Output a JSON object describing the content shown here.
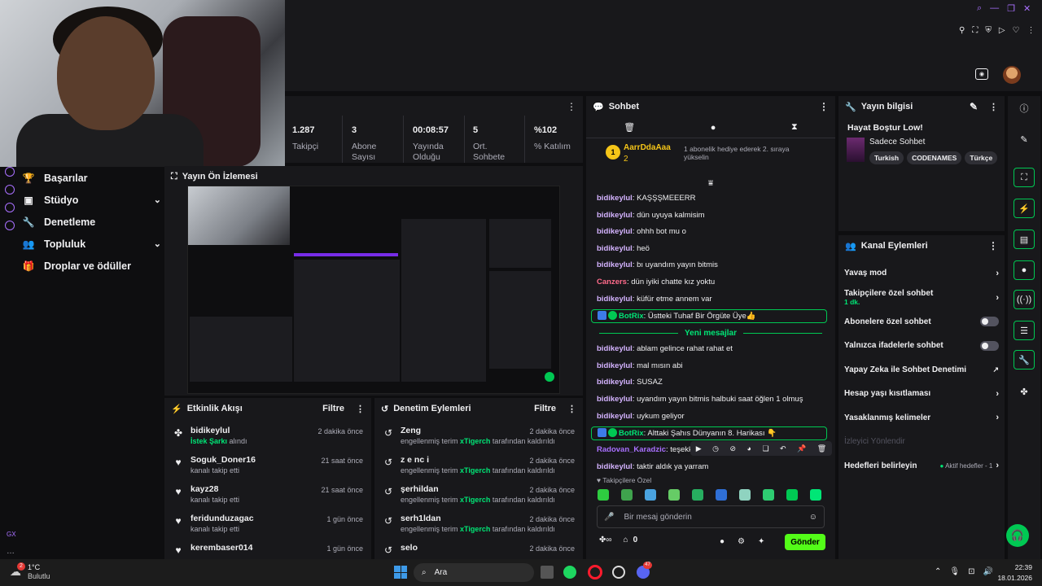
{
  "top": {
    "avatar_alt": "profile"
  },
  "nav": {
    "items": [
      {
        "label": "Başarılar",
        "icon": "trophy-icon",
        "expand": false
      },
      {
        "label": "Stüdyo",
        "icon": "video-icon",
        "expand": true
      },
      {
        "label": "Denetleme",
        "icon": "wrench-icon",
        "expand": false
      },
      {
        "label": "Topluluk",
        "icon": "people-icon",
        "expand": true
      },
      {
        "label": "Droplar ve ödüller",
        "icon": "gift-icon",
        "expand": false
      }
    ],
    "footer_label": "GX"
  },
  "stats": [
    {
      "value": "1.287",
      "label": "Takipçi"
    },
    {
      "value": "3",
      "label": "Abone Sayısı"
    },
    {
      "value": "00:08:57",
      "label": "Yayında Olduğu"
    },
    {
      "value": "5",
      "label": "Ort. Sohbete"
    },
    {
      "value": "%102",
      "label": "% Katılım"
    }
  ],
  "preview": {
    "title": "Yayın Ön İzlemesi"
  },
  "feed": {
    "title": "Etkinlik Akışı",
    "filter": "Filtre",
    "items": [
      {
        "name": "bidikeylul",
        "sub_highlight": "İstek Şarkı",
        "sub": " alındı",
        "time": "2 dakika önce",
        "icon": "sparkle-icon"
      },
      {
        "name": "Soguk_Doner16",
        "sub_highlight": "",
        "sub": "kanalı takip etti",
        "time": "21 saat önce",
        "icon": "heart-icon"
      },
      {
        "name": "kayz28",
        "sub_highlight": "",
        "sub": "kanalı takip etti",
        "time": "21 saat önce",
        "icon": "heart-icon"
      },
      {
        "name": "feridunduzagac",
        "sub_highlight": "",
        "sub": "kanalı takip etti",
        "time": "1 gün önce",
        "icon": "heart-icon"
      },
      {
        "name": "kerembaser014",
        "sub_highlight": "",
        "sub": "",
        "time": "1 gün önce",
        "icon": "heart-icon"
      }
    ]
  },
  "mod": {
    "title": "Denetim Eylemleri",
    "filter": "Filtre",
    "items": [
      {
        "name": "Zeng",
        "pre": "engellenmiş terim ",
        "who": "xTigerch",
        "post": " tarafından kaldırıldı",
        "time": "2 dakika önce"
      },
      {
        "name": "z e nc i",
        "pre": "engellenmiş terim ",
        "who": "xTigerch",
        "post": " tarafından kaldırıldı",
        "time": "2 dakika önce"
      },
      {
        "name": "şerhildan",
        "pre": "engellenmiş terim ",
        "who": "xTigerch",
        "post": " tarafından kaldırıldı",
        "time": "2 dakika önce"
      },
      {
        "name": "serh1ldan",
        "pre": "engellenmiş terim ",
        "who": "xTigerch",
        "post": " tarafından kaldırıldı",
        "time": "2 dakika önce"
      },
      {
        "name": "selo",
        "pre": "",
        "who": "",
        "post": "",
        "time": "2 dakika önce"
      }
    ]
  },
  "chat": {
    "title": "Sohbet",
    "gifter": {
      "rank": "1",
      "name": "AarrDdaAaa",
      "count": "2",
      "text": "1 abonelik hediye ederek 2. sıraya yükselin"
    },
    "messages_before": [
      {
        "user": "bidikeylul",
        "text": "KAŞŞŞMEEERR",
        "color": "#d4b3ff"
      },
      {
        "user": "bidikeylul",
        "text": "dün uyuya kalmisim",
        "color": "#d4b3ff"
      },
      {
        "user": "bidikeylul",
        "text": "ohhh bot mu o",
        "color": "#d4b3ff"
      },
      {
        "user": "bidikeylul",
        "text": "heö",
        "color": "#d4b3ff"
      },
      {
        "user": "bidikeylul",
        "text": "bı uyandım yayın bitmis",
        "color": "#d4b3ff"
      },
      {
        "user": "Canzers",
        "text": "dün iyiki chatte kız yoktu",
        "color": "#ff6b8b"
      },
      {
        "user": "bidikeylul",
        "text": "küfür etme annem var",
        "color": "#d4b3ff"
      },
      {
        "user": "BotRix",
        "text": "Üstteki Tuhaf Bir Örgüte Üye👍",
        "color": "#00e676",
        "bot": true
      }
    ],
    "new_messages": "Yeni mesajlar",
    "messages_after": [
      {
        "user": "bidikeylul",
        "text": "ablam gelince rahat rahat et",
        "color": "#d4b3ff"
      },
      {
        "user": "bidikeylul",
        "text": "mal mısın abi",
        "color": "#d4b3ff"
      },
      {
        "user": "bidikeylul",
        "text": "SUSAZ",
        "color": "#d4b3ff"
      },
      {
        "user": "bidikeylul",
        "text": "uyandım yayın bitmis halbuki saat öğlen 1 olmuş",
        "color": "#d4b3ff"
      },
      {
        "user": "bidikeylul",
        "text": "uykum geliyor",
        "color": "#d4b3ff"
      },
      {
        "user": "BotRix",
        "text": "Alttaki Şahıs Dünyanın 8. Harikası 👇",
        "color": "#00e676",
        "bot": true
      },
      {
        "user": "Radovan_Karadzic",
        "text": "teşekkü",
        "color": "#a970ff"
      },
      {
        "user": "bidikeylul",
        "text": "taktir aldık ya yarram",
        "color": "#d4b3ff"
      }
    ],
    "follower_only": "Takipçilere Özel",
    "placeholder": "Bir mesaj gönderin",
    "points": "0",
    "send": "Gönder"
  },
  "info": {
    "title": "Yayın bilgisi",
    "stream_title": "Hayat Boştur Low!",
    "category": "Sadece Sohbet",
    "tags": [
      "Turkish",
      "CODENAMES",
      "Türkçe"
    ]
  },
  "actions": {
    "title": "Kanal Eylemleri",
    "items": [
      {
        "label": "Yavaş mod",
        "sub": "",
        "kind": "chevron"
      },
      {
        "label": "Takipçilere özel sohbet",
        "sub": "1 dk.",
        "kind": "chevron"
      },
      {
        "label": "Abonelere özel sohbet",
        "sub": "",
        "kind": "toggle"
      },
      {
        "label": "Yalnızca ifadelerle sohbet",
        "sub": "",
        "kind": "toggle"
      },
      {
        "label": "Yapay Zeka ile Sohbet Denetimi",
        "sub": "",
        "kind": "external"
      },
      {
        "label": "Hesap yaşı kısıtlaması",
        "sub": "",
        "kind": "chevron"
      },
      {
        "label": "Yasaklanmış kelimeler",
        "sub": "",
        "kind": "chevron"
      },
      {
        "label": "İzleyici Yönlendir",
        "sub": "",
        "kind": "disabled"
      },
      {
        "label": "Hedefleri belirleyin",
        "sub": "",
        "kind": "goal",
        "note": "Aktif hedefler - 1"
      }
    ]
  },
  "taskbar": {
    "temp": "1°C",
    "weather": "Bulutlu",
    "search": "Ara",
    "time": "22:39",
    "date": "18.01.2026",
    "badge": "2",
    "discord_badge": "47"
  }
}
